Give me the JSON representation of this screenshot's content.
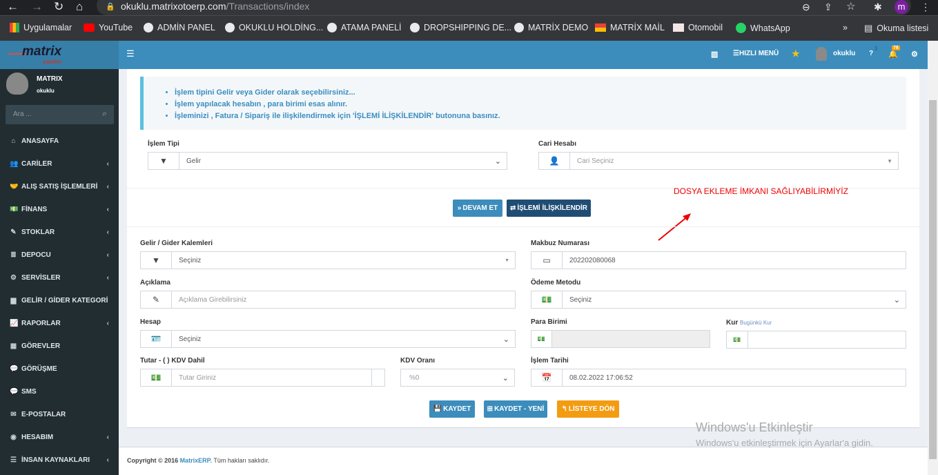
{
  "browser": {
    "url_host": "okuklu.matrixotoerp.com",
    "url_path": "/Transactions/index",
    "profile": "m",
    "bookmarks": [
      "Uygulamalar",
      "YouTube",
      "ADMİN PANEL",
      "OKUKLU HOLDİNG...",
      "ATAMA PANELİ",
      "DROPSHIPPING DE...",
      "MATRİX DEMO",
      "MATRİX MAİL",
      "Otomobil",
      "WhatsApp"
    ],
    "more": "»",
    "reading_list": "Okuma listesi"
  },
  "logo": {
    "name": "matrix",
    "sub": "yazılım"
  },
  "header": {
    "menu_icon": "☰",
    "quick_menu": "HIZLI MENÜ",
    "user": "okuklu",
    "help_badge": "3",
    "notif_badge": "78"
  },
  "sidebar": {
    "user_name": "MATRIX",
    "user_sub": "okuklu",
    "search_placeholder": "Ara ...",
    "items": [
      {
        "label": "ANASAYFA",
        "icon": "home",
        "chev": false
      },
      {
        "label": "CARİLER",
        "icon": "users",
        "chev": true
      },
      {
        "label": "ALIŞ SATIŞ İŞLEMLERİ",
        "icon": "handshake",
        "chev": true
      },
      {
        "label": "FİNANS",
        "icon": "money",
        "chev": true
      },
      {
        "label": "STOKLAR",
        "icon": "edit",
        "chev": true
      },
      {
        "label": "DEPOCU",
        "icon": "database",
        "chev": true
      },
      {
        "label": "SERVİSLER",
        "icon": "cogs",
        "chev": true
      },
      {
        "label": "GELİR / GİDER KATEGORİ",
        "icon": "file",
        "chev": false
      },
      {
        "label": "RAPORLAR",
        "icon": "chart",
        "chev": true
      },
      {
        "label": "GÖREVLER",
        "icon": "grid",
        "chev": false
      },
      {
        "label": "GÖRÜŞME",
        "icon": "comment",
        "chev": false
      },
      {
        "label": "SMS",
        "icon": "comment",
        "chev": false
      },
      {
        "label": "E-POSTALAR",
        "icon": "envelope",
        "chev": false
      },
      {
        "label": "HESABIM",
        "icon": "user-circle",
        "chev": true
      },
      {
        "label": "İNSAN KAYNAKLARI",
        "icon": "list",
        "chev": true
      }
    ]
  },
  "info": [
    "İşlem tipini Gelir veya Gider olarak seçebilirsiniz...",
    "İşlem yapılacak hesabın , para birimi esas alınır.",
    "İşleminizi , Fatura / Sipariş ile ilişkilendirmek için 'İŞLEMİ İLİŞKİLENDİR' butonuna basınız."
  ],
  "form": {
    "islem_tipi_label": "İşlem Tipi",
    "islem_tipi_value": "Gelir",
    "cari_label": "Cari Hesabı",
    "cari_value": "Cari Seçiniz",
    "devam": "DEVAM ET",
    "iliskilendir": "İŞLEMİ İLİŞKİLENDİR",
    "annotation": "DOSYA EKLEME İMKANI SAĞLIYABİLİRMİYİZ",
    "kalem_label": "Gelir / Gider Kalemleri",
    "kalem_value": "Seçiniz",
    "makbuz_label": "Makbuz Numarası",
    "makbuz_value": "202202080068",
    "aciklama_label": "Açıklama",
    "aciklama_placeholder": "Açıklama Girebilirsiniz",
    "odeme_label": "Ödeme Metodu",
    "odeme_value": "Seçiniz",
    "hesap_label": "Hesap",
    "hesap_value": "Seçiniz",
    "para_label": "Para Birimi",
    "para_value": "",
    "kur_label": "Kur",
    "kur_link": "Bugünkü Kur",
    "kur_value": "",
    "tutar_label": "Tutar - (  ) KDV Dahil",
    "tutar_placeholder": "Tutar Giriniz",
    "kdv_label": "KDV Oranı",
    "kdv_value": "%0",
    "tarih_label": "İşlem Tarihi",
    "tarih_value": "08.02.2022 17:06:52",
    "kaydet": "KAYDET",
    "kaydet_yeni": "KAYDET - YENİ",
    "listeye_don": "LİSTEYE DÖN"
  },
  "footer": {
    "prefix": "Copyright © 2016 ",
    "brand": "MatrixERP.",
    "suffix": " Tüm hakları saklıdır."
  },
  "watermark": {
    "title": "Windows'u Etkinleştir",
    "sub": "Windows'u etkinleştirmek için Ayarlar'a gidin."
  },
  "colors": {
    "primary": "#3c8dbc",
    "dark_blue": "#204d74",
    "orange": "#f39c12",
    "sidebar": "#222d32"
  }
}
